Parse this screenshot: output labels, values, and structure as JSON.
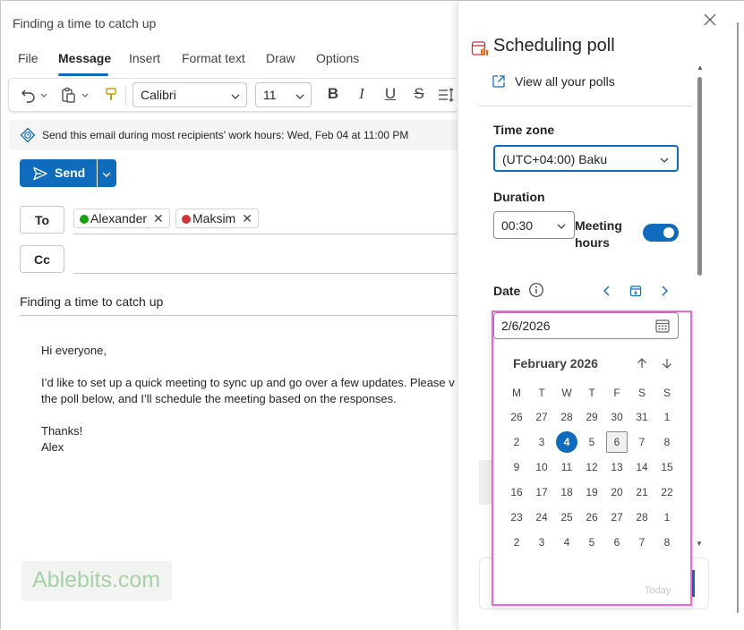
{
  "window": {
    "title": "Finding a time to catch up"
  },
  "menu": {
    "items": [
      "File",
      "Message",
      "Insert",
      "Format text",
      "Draw",
      "Options"
    ],
    "active": "Message"
  },
  "toolbar": {
    "font": "Calibri",
    "size": "11",
    "bold": "B",
    "italic": "I",
    "underline": "U",
    "strike": "S"
  },
  "info_bar": {
    "text": "Send this email during most recipients' work hours: Wed, Feb 04 at 11:00 PM"
  },
  "send": {
    "label": "Send"
  },
  "to": {
    "label": "To",
    "recipients": [
      {
        "name": "Alexander",
        "status_color": "#13a10e"
      },
      {
        "name": "Maksim",
        "status_color": "#d13438"
      }
    ]
  },
  "cc": {
    "label": "Cc"
  },
  "subject": "Finding a time to catch up",
  "body": {
    "greeting": "Hi everyone,",
    "line1": "I’d like to set up a quick meeting to sync up and go over a few updates. Please v",
    "line2": "the poll below, and I’ll schedule the meeting based on the responses.",
    "thanks": "Thanks!",
    "signature": "Alex"
  },
  "watermark": "Ablebits.com",
  "poll": {
    "title": "Scheduling poll",
    "view_all": "View all your polls",
    "timezone_label": "Time zone",
    "timezone_value": "(UTC+04:00) Baku",
    "duration_label": "Duration",
    "duration_value": "00:30",
    "meeting_hours_label": "Meeting hours",
    "meeting_hours_on": true,
    "date_label": "Date",
    "date_value": "2/6/2026"
  },
  "calendar": {
    "month_label": "February 2026",
    "weekdays": [
      "M",
      "T",
      "W",
      "T",
      "F",
      "S",
      "S"
    ],
    "weeks": [
      [
        "26",
        "27",
        "28",
        "29",
        "30",
        "31",
        "1"
      ],
      [
        "2",
        "3",
        "4",
        "5",
        "6",
        "7",
        "8"
      ],
      [
        "9",
        "10",
        "11",
        "12",
        "13",
        "14",
        "15"
      ],
      [
        "16",
        "17",
        "18",
        "19",
        "20",
        "21",
        "22"
      ],
      [
        "23",
        "24",
        "25",
        "26",
        "27",
        "28",
        "1"
      ],
      [
        "2",
        "3",
        "4",
        "5",
        "6",
        "7",
        "8"
      ]
    ],
    "today": "4",
    "selected": "6",
    "today_link": "Today"
  },
  "colors": {
    "accent": "#0f6cbd",
    "highlight_border": "#e868d8",
    "present": "#13a10e",
    "busy": "#d13438"
  }
}
